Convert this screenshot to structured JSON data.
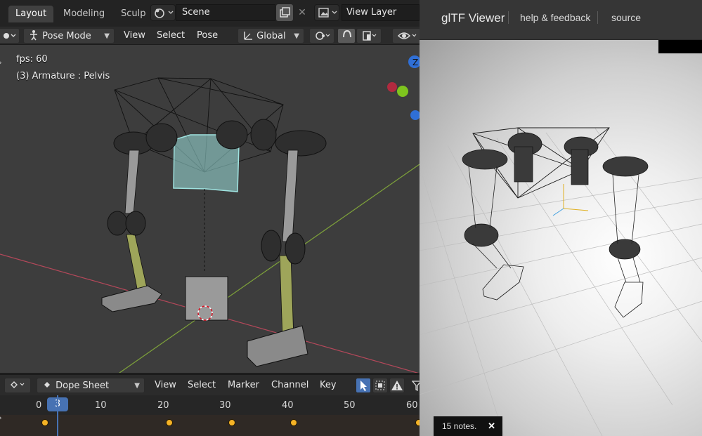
{
  "blender": {
    "workspace_tabs": [
      "Layout",
      "Modeling",
      "Sculp"
    ],
    "scene": {
      "name": "Scene",
      "close_glyph": "✕"
    },
    "view_layer": {
      "name": "View Layer"
    },
    "viewport_header": {
      "mode": "Pose Mode",
      "menus": [
        "View",
        "Select",
        "Pose"
      ],
      "orientation": "Global"
    },
    "viewport": {
      "fps": "fps: 60",
      "active_object": "(3) Armature : Pelvis",
      "gizmo_axis_label": "Z"
    },
    "dope_sheet": {
      "editor": "Dope Sheet",
      "menus": [
        "View",
        "Select",
        "Marker",
        "Channel",
        "Key"
      ],
      "current_frame": "3",
      "frame_labels": [
        "0",
        "10",
        "20",
        "30",
        "40",
        "50",
        "60"
      ],
      "keyframes": [
        0,
        20,
        30,
        40,
        60
      ]
    }
  },
  "gltf_viewer": {
    "title": "glTF Viewer",
    "links": [
      "help & feedback",
      "source"
    ],
    "notes": "15 notes.",
    "notes_close": "✕"
  },
  "colors": {
    "accent_blue": "#4772b3",
    "keyframe": "#f5b326",
    "bone_selected": "#9fe3e0"
  }
}
